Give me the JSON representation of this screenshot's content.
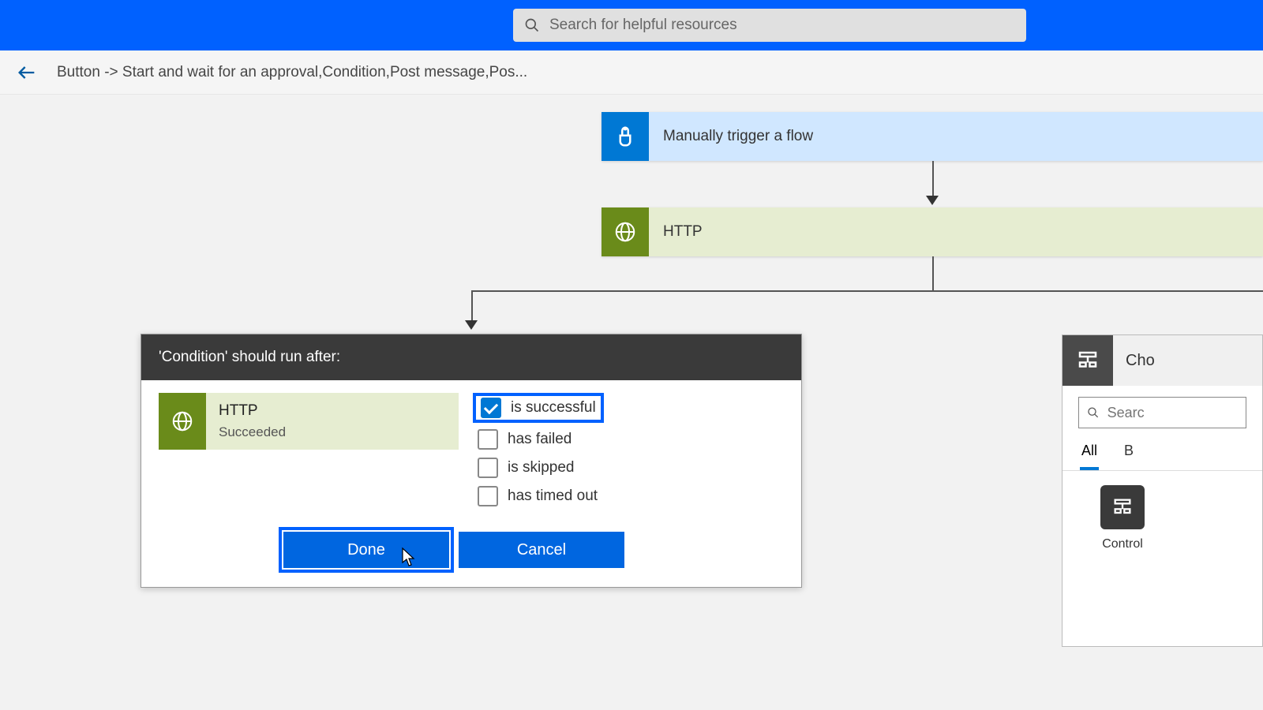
{
  "search": {
    "placeholder": "Search for helpful resources"
  },
  "breadcrumb": "Button -> Start and wait for an approval,Condition,Post message,Pos...",
  "flow": {
    "trigger_label": "Manually trigger a flow",
    "http_label": "HTTP"
  },
  "runafter": {
    "title": "'Condition' should run after:",
    "prev_name": "HTTP",
    "prev_status": "Succeeded",
    "options": {
      "successful": "is successful",
      "failed": "has failed",
      "skipped": "is skipped",
      "timedout": "has timed out"
    },
    "done": "Done",
    "cancel": "Cancel"
  },
  "picker": {
    "title": "Cho",
    "search_placeholder": "Searc",
    "tab_all": "All",
    "tab_b": "B",
    "item_control": "Control"
  }
}
